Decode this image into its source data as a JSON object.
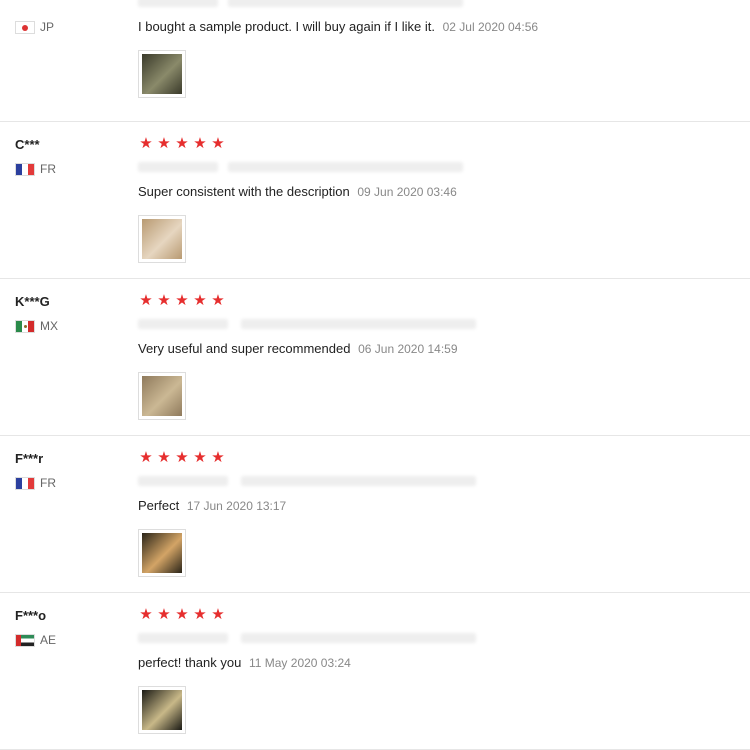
{
  "reviews": [
    {
      "name": "",
      "flag": "jp",
      "country": "JP",
      "stars": 0,
      "text": "I bought a sample product. I will buy again if I like it.",
      "date": "02 Jul 2020 04:56",
      "thumb_colors": [
        "#3a3a2a",
        "#8a8a6a"
      ]
    },
    {
      "name": "C***",
      "flag": "fr",
      "country": "FR",
      "stars": 5,
      "text": "Super consistent with the description",
      "date": "09 Jun 2020 03:46",
      "thumb_colors": [
        "#b89a72",
        "#e6d6c0"
      ]
    },
    {
      "name": "K***G",
      "flag": "mx",
      "country": "MX",
      "stars": 5,
      "text": "Very useful and super recommended",
      "date": "06 Jun 2020 14:59",
      "thumb_colors": [
        "#8f7a5c",
        "#cbb894"
      ]
    },
    {
      "name": "F***r",
      "flag": "fr",
      "country": "FR",
      "stars": 5,
      "text": "Perfect",
      "date": "17 Jun 2020 13:17",
      "thumb_colors": [
        "#2a2418",
        "#d3a466"
      ]
    },
    {
      "name": "F***o",
      "flag": "ae",
      "country": "AE",
      "stars": 5,
      "text": "perfect! thank you",
      "date": "11 May 2020 03:24",
      "thumb_colors": [
        "#1a1a14",
        "#c8b888"
      ]
    }
  ],
  "star_color": "#e62e2e"
}
